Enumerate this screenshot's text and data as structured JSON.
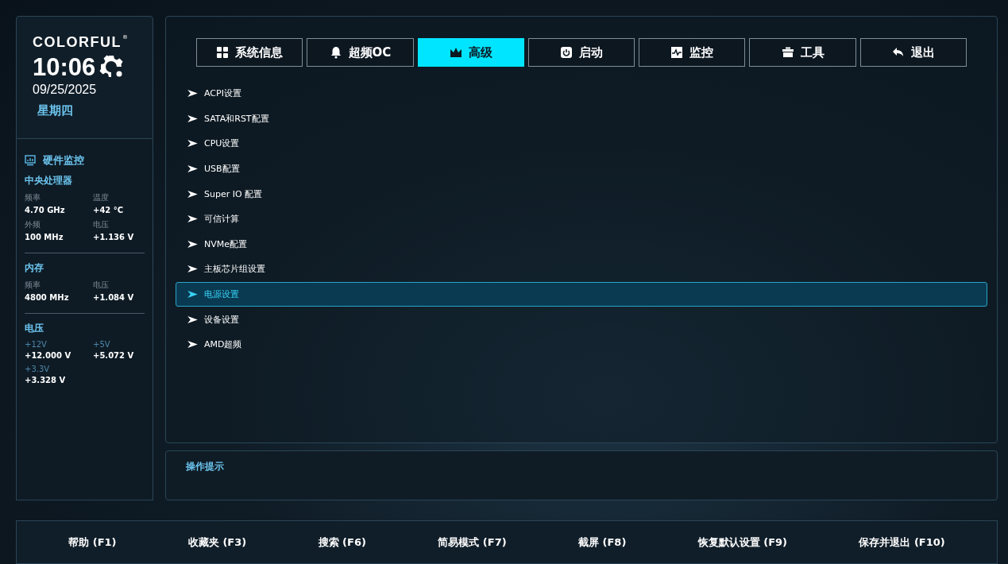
{
  "brand": {
    "logo": "COLORFUL",
    "registered": "®",
    "time": "10:06",
    "date": "09/25/2025",
    "weekday": "星期四"
  },
  "monitor": {
    "title": "硬件监控",
    "sections": [
      {
        "title": "中央处理器",
        "kind": "plain",
        "items": [
          {
            "label": "频率",
            "value": "4.70 GHz"
          },
          {
            "label": "温度",
            "value": "+42 °C"
          },
          {
            "label": "外频",
            "value": "100 MHz"
          },
          {
            "label": "电压",
            "value": "+1.136 V"
          }
        ]
      },
      {
        "title": "内存",
        "kind": "plain",
        "items": [
          {
            "label": "频率",
            "value": "4800 MHz"
          },
          {
            "label": "电压",
            "value": "+1.084 V"
          }
        ]
      },
      {
        "title": "电压",
        "kind": "rail",
        "items": [
          {
            "label": "+12V",
            "value": "+12.000 V"
          },
          {
            "label": "+5V",
            "value": "+5.072 V"
          },
          {
            "label": "+3.3V",
            "value": "+3.328 V"
          }
        ]
      }
    ]
  },
  "tabs": [
    {
      "label": "系统信息",
      "kind": "grid",
      "selected": false
    },
    {
      "label": "超频OC",
      "kind": "bell",
      "selected": false
    },
    {
      "label": "高级",
      "kind": "crown",
      "selected": true
    },
    {
      "label": "启动",
      "kind": "power",
      "selected": false
    },
    {
      "label": "监控",
      "kind": "pulse",
      "selected": false
    },
    {
      "label": "工具",
      "kind": "toolbox",
      "selected": false
    },
    {
      "label": "退出",
      "kind": "back",
      "selected": false
    }
  ],
  "menu": [
    {
      "label": "ACPI设置",
      "selected": false
    },
    {
      "label": "SATA和RST配置",
      "selected": false
    },
    {
      "label": "CPU设置",
      "selected": false
    },
    {
      "label": "USB配置",
      "selected": false
    },
    {
      "label": "Super IO 配置",
      "selected": false
    },
    {
      "label": "可信计算",
      "selected": false
    },
    {
      "label": "NVMe配置",
      "selected": false
    },
    {
      "label": "主板芯片组设置",
      "selected": false
    },
    {
      "label": "电源设置",
      "selected": true
    },
    {
      "label": "设备设置",
      "selected": false
    },
    {
      "label": "AMD超频",
      "selected": false
    }
  ],
  "hint": {
    "title": "操作提示"
  },
  "footer": [
    "帮助 (F1)",
    "收藏夹 (F3)",
    "搜索 (F6)",
    "简易模式 (F7)",
    "截屏 (F8)",
    "恢复默认设置 (F9)",
    "保存并退出 (F10)"
  ]
}
